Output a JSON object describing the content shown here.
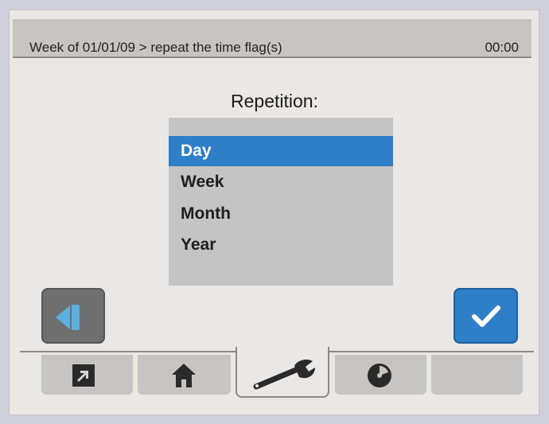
{
  "header": {
    "title": "Week of 01/01/09 > repeat the time flag(s)",
    "time": "00:00"
  },
  "dialog": {
    "heading": "Repetition:",
    "options": [
      {
        "label": "Day",
        "selected": true
      },
      {
        "label": "Week",
        "selected": false
      },
      {
        "label": "Month",
        "selected": false
      },
      {
        "label": "Year",
        "selected": false
      }
    ]
  },
  "buttons": {
    "back_icon": "back-icon",
    "confirm_icon": "checkmark-icon"
  },
  "tabs": [
    {
      "icon": "external-link-icon",
      "active": false
    },
    {
      "icon": "home-icon",
      "active": false
    },
    {
      "icon": "wrench-icon",
      "active": true
    },
    {
      "icon": "disc-icon",
      "active": false
    },
    {
      "icon": "",
      "active": false
    }
  ],
  "colors": {
    "accent": "#2f7fc8",
    "back_arrow": "#5fb0e0",
    "panel": "#eae7e4",
    "list_bg": "#c4c4c4"
  }
}
